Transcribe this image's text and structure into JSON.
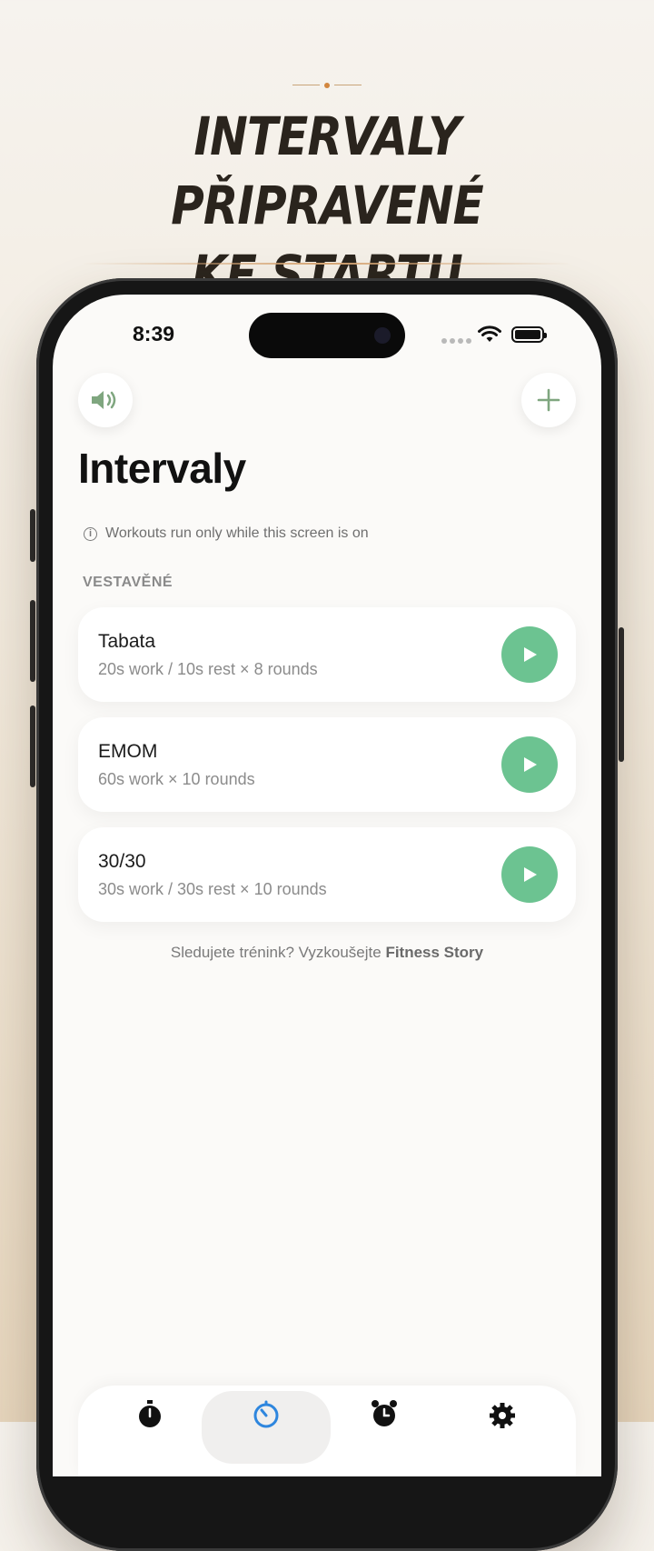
{
  "promo": {
    "headline_line1": "INTERVALY PŘIPRAVENÉ",
    "headline_line2": "KE STARTU"
  },
  "status_bar": {
    "time": "8:39"
  },
  "toolbar": {
    "sound_icon": "speaker-icon",
    "add_icon": "plus-icon"
  },
  "page": {
    "title": "Intervaly",
    "notice": "Workouts run only while this screen is on",
    "section_label": "VESTAVĚNÉ"
  },
  "workouts": [
    {
      "name": "Tabata",
      "description": "20s work / 10s rest × 8 rounds"
    },
    {
      "name": "EMOM",
      "description": "60s work × 10 rounds"
    },
    {
      "name": "30/30",
      "description": "30s work / 30s rest × 10 rounds"
    }
  ],
  "footer": {
    "prefix": "Sledujete trénink? Vyzkoušejte ",
    "link": "Fitness Story"
  },
  "tabbar": {
    "tabs": [
      {
        "icon": "stopwatch-icon",
        "active": false
      },
      {
        "icon": "timer-icon",
        "active": true
      },
      {
        "icon": "alarm-icon",
        "active": false
      },
      {
        "icon": "gear-icon",
        "active": false
      }
    ]
  },
  "colors": {
    "accent_green": "#6cc391",
    "active_tab_blue": "#2e86de",
    "icon_green": "#7fa67f"
  }
}
